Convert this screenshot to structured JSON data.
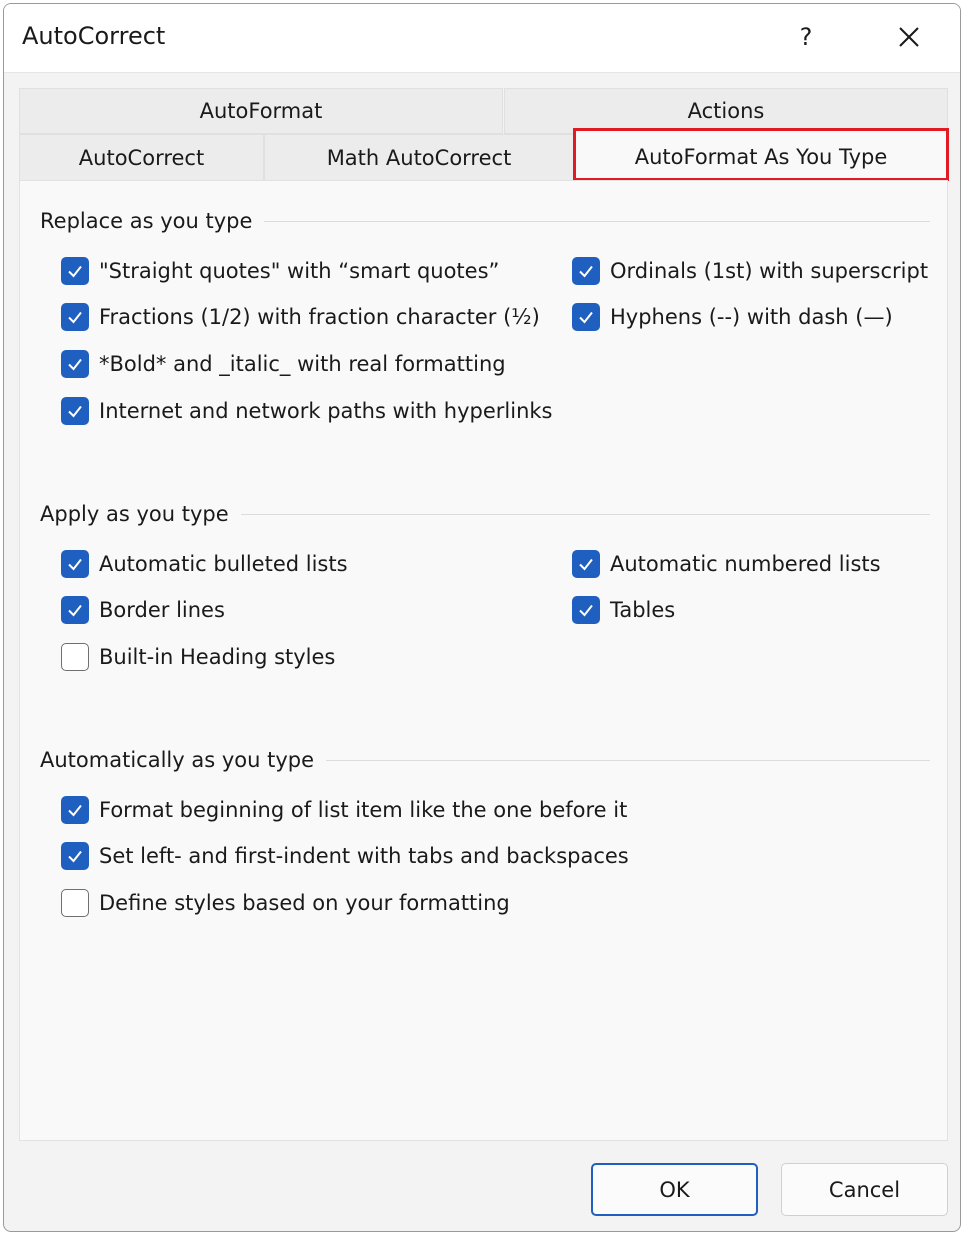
{
  "window": {
    "title": "AutoCorrect",
    "help_label": "?"
  },
  "icons": {
    "close": "close-icon",
    "check": "checkmark-icon"
  },
  "tabs": {
    "autoformat": "AutoFormat",
    "actions": "Actions",
    "autocorrect": "AutoCorrect",
    "math_autocorrect": "Math AutoCorrect",
    "autoformat_as_you_type": "AutoFormat As You Type"
  },
  "active_tab": "AutoFormat As You Type",
  "colors": {
    "accent": "#1f5fbf",
    "highlight": "#e01b24"
  },
  "replace": {
    "title": "Replace as you type",
    "straight_quotes": {
      "label": "\"Straight quotes\" with “smart quotes”",
      "checked": true
    },
    "ordinals": {
      "label": "Ordinals (1st) with superscript",
      "checked": true
    },
    "fractions": {
      "label": "Fractions (1/2) with fraction character (½)",
      "checked": true
    },
    "hyphens": {
      "label": "Hyphens (--) with dash (—)",
      "checked": true
    },
    "bold_italic": {
      "label": "*Bold* and _italic_ with real formatting",
      "checked": true
    },
    "internet_paths": {
      "label": "Internet and network paths with hyperlinks",
      "checked": true
    }
  },
  "apply": {
    "title": "Apply as you type",
    "bulleted": {
      "label": "Automatic bulleted lists",
      "checked": true
    },
    "numbered": {
      "label": "Automatic numbered lists",
      "checked": true
    },
    "border_lines": {
      "label": "Border lines",
      "checked": true
    },
    "tables": {
      "label": "Tables",
      "checked": true
    },
    "heading_styles": {
      "label": "Built-in Heading styles",
      "checked": false
    }
  },
  "automatically": {
    "title": "Automatically as you type",
    "format_beginning": {
      "label": "Format beginning of list item like the one before it",
      "checked": true
    },
    "set_indent": {
      "label": "Set left- and first-indent with tabs and backspaces",
      "checked": true
    },
    "define_styles": {
      "label": "Define styles based on your formatting",
      "checked": false
    }
  },
  "buttons": {
    "ok": "OK",
    "cancel": "Cancel"
  }
}
